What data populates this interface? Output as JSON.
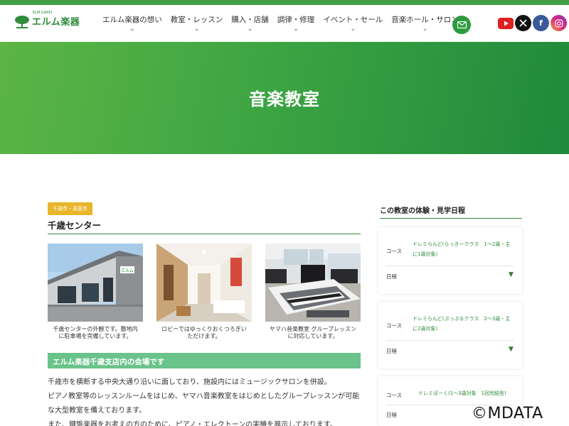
{
  "brand": {
    "name": "エルム楽器",
    "tagline": "ELM GAKKI",
    "colors": {
      "primary": "#2e8b3a",
      "hero_start": "#5cb545",
      "hero_end": "#1f8a3c",
      "tag": "#e8b52b",
      "venue_bar": "#6ac38a"
    }
  },
  "nav": {
    "items": [
      {
        "label": "エルム楽器の想い"
      },
      {
        "label": "教室・レッスン"
      },
      {
        "label": "購入・店舗"
      },
      {
        "label": "調律・修理"
      },
      {
        "label": "イベント・セール"
      },
      {
        "label": "音楽ホール・サロン"
      }
    ],
    "mail_icon": "mail-icon",
    "social": [
      "youtube-icon",
      "x-icon",
      "facebook-icon",
      "instagram-icon"
    ]
  },
  "hero": {
    "title": "音楽教室"
  },
  "center": {
    "tag": "千歳市・恵庭市",
    "title": "千歳センター",
    "photos": [
      {
        "caption_1": "千歳センターの外観です。敷地内",
        "caption_2": "に駐車場を完備しています。",
        "sign": "エルム"
      },
      {
        "caption_1": "ロビーではゆっくりおくつろぎい",
        "caption_2": "ただけます。"
      },
      {
        "caption_1": "ヤマハ音楽教室 グループレッスン",
        "caption_2": "に対応しています。"
      }
    ],
    "venue_heading": "エルム楽器千歳支店内の会場です",
    "body": [
      "千歳市を横断する中央大通り沿いに面しており、施設内にはミュージックサロンを併設。",
      "ピアノ教室等のレッスンルームをはじめ、ヤマハ音楽教室をはじめとしたグループレッスンが可能",
      "な大型教室を備えております。",
      "また、鍵盤楽器をお考えの方のために、ピアノ・エレクトーンの実機を展示しております。"
    ]
  },
  "sidebar": {
    "title": "この教室の体験・見学日程",
    "course_label": "コース",
    "schedule_label": "日程",
    "cards": [
      {
        "course_1": "ドレミらんど(らっきークラス　1〜2歳・主",
        "course_2": "に1歳対象)"
      },
      {
        "course_1": "ドレミらんど(ぷっぷるクラス　2〜3歳・主",
        "course_2": "に2歳対象)"
      },
      {
        "course_1": "ドレミぱーく(1〜3歳対象　1回完結型)",
        "course_2": ""
      }
    ]
  },
  "watermark": "©MDATA"
}
